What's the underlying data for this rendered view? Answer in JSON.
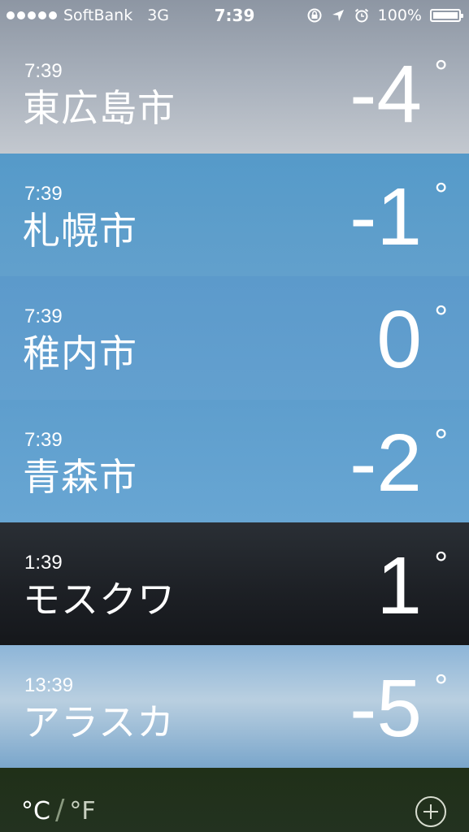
{
  "status_bar": {
    "carrier": "SoftBank",
    "network": "3G",
    "time": "7:39",
    "battery": "100%"
  },
  "cities": [
    {
      "time": "7:39",
      "name": "東広島市",
      "temp": "-4",
      "degree": "°",
      "bg": "#a9b1bc"
    },
    {
      "time": "7:39",
      "name": "札幌市",
      "temp": "-1",
      "degree": "°",
      "bg": "#5e9bc8"
    },
    {
      "time": "7:39",
      "name": "稚内市",
      "temp": "0",
      "degree": "°",
      "bg": "#5f9ccb"
    },
    {
      "time": "7:39",
      "name": "青森市",
      "temp": "-2",
      "degree": "°",
      "bg": "#62a1cf"
    },
    {
      "time": "1:39",
      "name": "モスクワ",
      "temp": "1",
      "degree": "°",
      "bg": "#1e2126"
    },
    {
      "time": "13:39",
      "name": "アラスカ",
      "temp": "-5",
      "degree": "°",
      "bg": "#7fa9cd"
    }
  ],
  "footer": {
    "celsius": "°C",
    "separator": "/",
    "fahrenheit": "°F"
  }
}
